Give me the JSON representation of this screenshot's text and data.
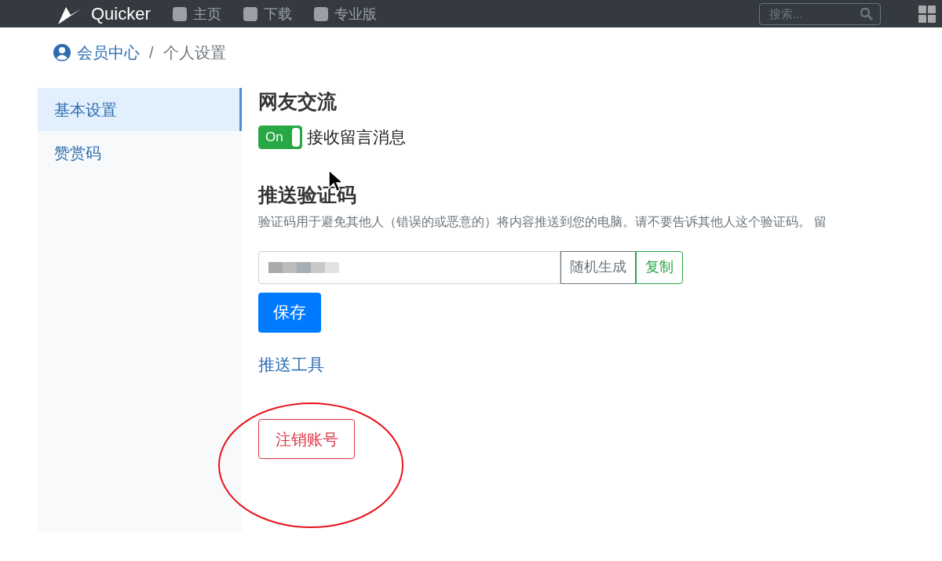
{
  "navbar": {
    "brand": "Quicker",
    "links": [
      "主页",
      "下载",
      "专业版"
    ],
    "search": {
      "placeholder": "搜索..."
    }
  },
  "breadcrumb": [
    "会员中心",
    "/",
    "个人设置"
  ],
  "sidebar": {
    "items": [
      {
        "label": "基本设置",
        "selected": true
      },
      {
        "label": "赞赏码",
        "selected": false
      }
    ]
  },
  "message_section": {
    "title": "网友交流",
    "toggle": {
      "label": "On",
      "on": true
    },
    "toggle_text": "接收留言消息"
  },
  "push_section": {
    "title": "推送验证码",
    "description": "验证码用于避免其他人（错误的或恶意的）将内容推送到您的电脑。请不要告诉其他人这个验证码。 留",
    "buttons": [
      "随机生成",
      "复制"
    ],
    "save": "保存",
    "link": "推送工具"
  },
  "delete_button": "注销账号"
}
